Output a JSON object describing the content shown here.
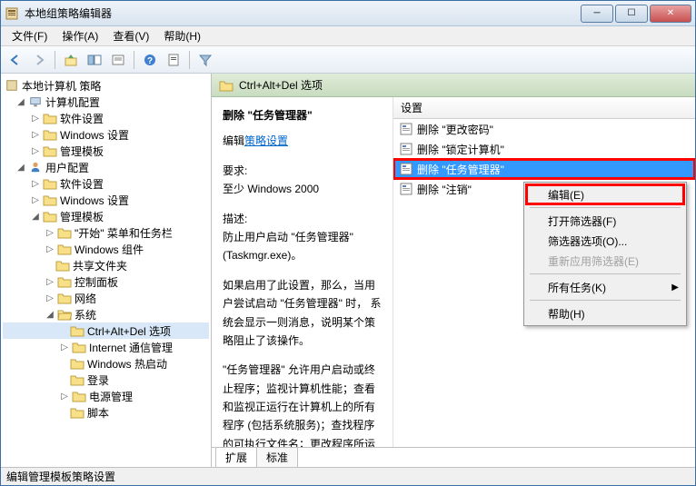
{
  "window": {
    "title": "本地组策略编辑器"
  },
  "menubar": [
    {
      "label": "文件(F)"
    },
    {
      "label": "操作(A)"
    },
    {
      "label": "查看(V)"
    },
    {
      "label": "帮助(H)"
    }
  ],
  "tree": {
    "root": {
      "label": "本地计算机 策略"
    },
    "computer": {
      "label": "计算机配置"
    },
    "comp_software": {
      "label": "软件设置"
    },
    "comp_windows": {
      "label": "Windows 设置"
    },
    "comp_templates": {
      "label": "管理模板"
    },
    "user": {
      "label": "用户配置"
    },
    "user_software": {
      "label": "软件设置"
    },
    "user_windows": {
      "label": "Windows 设置"
    },
    "user_templates": {
      "label": "管理模板"
    },
    "start_menu": {
      "label": "\"开始\" 菜单和任务栏"
    },
    "win_components": {
      "label": "Windows 组件"
    },
    "shared_folders": {
      "label": "共享文件夹"
    },
    "control_panel": {
      "label": "控制面板"
    },
    "network": {
      "label": "网络"
    },
    "system": {
      "label": "系统"
    },
    "ctrl_alt_del": {
      "label": "Ctrl+Alt+Del 选项"
    },
    "internet_mgmt": {
      "label": "Internet 通信管理"
    },
    "win_boot": {
      "label": "Windows 热启动"
    },
    "login": {
      "label": "登录"
    },
    "power_mgmt": {
      "label": "电源管理"
    },
    "script": {
      "label": "脚本"
    }
  },
  "header": {
    "title": "Ctrl+Alt+Del 选项"
  },
  "detail": {
    "title": "删除 \"任务管理器\"",
    "edit_prefix": "编辑",
    "edit_link": "策略设置",
    "req_label": "要求:",
    "req_value": "至少 Windows 2000",
    "desc_label": "描述:",
    "desc1": "防止用户启动 \"任务管理器\" (Taskmgr.exe)。",
    "desc2": "如果启用了此设置，那么，当用户尝试启动 \"任务管理器\" 时， 系统会显示一则消息，说明某个策略阻止了该操作。",
    "desc3": "\"任务管理器\" 允许用户启动或终止程序；监视计算机性能；查看和监视正运行在计算机上的所有程序 (包括系统服务)；查找程序的可执行文件名；更改程序所运行的进程"
  },
  "settings_col": {
    "header": "设置"
  },
  "settings": [
    {
      "label": "删除 \"更改密码\""
    },
    {
      "label": "删除 \"锁定计算机\""
    },
    {
      "label": "删除 \"任务管理器\""
    },
    {
      "label": "删除 \"注销\""
    }
  ],
  "context_menu": {
    "edit": "编辑(E)",
    "filter_on": "打开筛选器(F)",
    "filter_opts": "筛选器选项(O)...",
    "filter_reapply": "重新应用筛选器(E)",
    "all_tasks": "所有任务(K)",
    "help": "帮助(H)"
  },
  "tabs": {
    "extended": "扩展",
    "standard": "标准"
  },
  "statusbar": {
    "text": "编辑管理模板策略设置"
  }
}
